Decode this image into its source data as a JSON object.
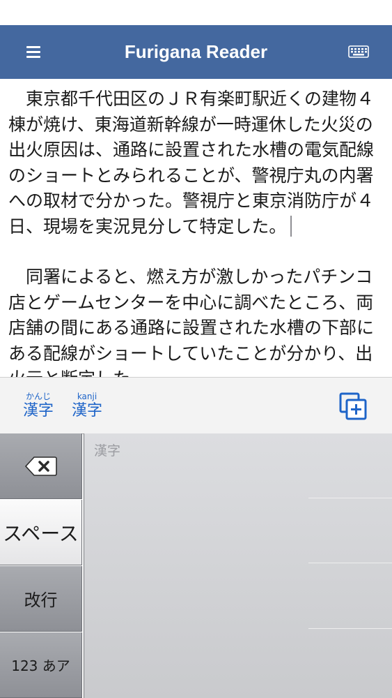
{
  "app": {
    "title": "Furigana Reader"
  },
  "nav": {
    "menu_icon": "hamburger-menu-icon",
    "keyboard_icon": "keyboard-icon"
  },
  "document": {
    "paragraphs": [
      "東京都千代田区のＪＲ有楽町駅近くの建物４棟が焼け、東海道新幹線が一時運休した火災の出火原因は、通路に設置された水槽の電気配線のショートとみられることが、警視庁丸の内署への取材で分かった。警視庁と東京消防庁が４日、現場を実況見分して特定した。",
      "同署によると、燃え方が激しかったパチンコ店とゲームセンターを中心に調べたところ、両店舗の間にある通路に設置された水槽の下部にある配線がショートしていたことが分かり、出火元と断定した。"
    ]
  },
  "conversion_bar": {
    "options": [
      {
        "ruby": "かんじ",
        "base": "漢字"
      },
      {
        "ruby": "kanji",
        "base": "漢字"
      }
    ],
    "copy_icon": "copy-add-icon"
  },
  "keyboard": {
    "delete_icon": "backspace-icon",
    "space_label": "スペース",
    "return_label": "改行",
    "mode_label": "123 あア",
    "input_placeholder": "漢字"
  },
  "colors": {
    "nav_background": "#44689f",
    "accent_blue": "#1e64c8"
  }
}
